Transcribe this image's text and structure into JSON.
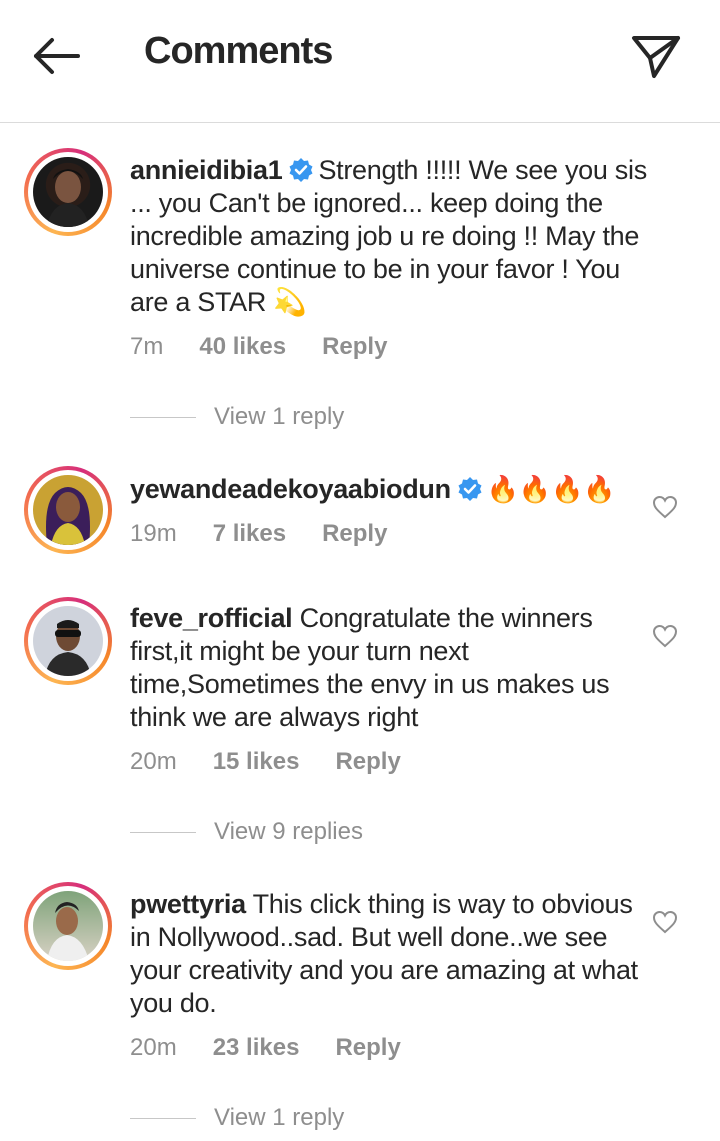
{
  "header": {
    "title": "Comments"
  },
  "comments": [
    {
      "username": "annieidibia1",
      "text": "Strength !!!!! We see you sis ... you Can't be ignored... keep doing the incredible amazing job u re  doing !! May the universe continue to be in your favor ! You are a STAR 💫",
      "time": "7m",
      "likes": "40 likes",
      "reply": "Reply",
      "view_replies": "View 1 reply"
    },
    {
      "username": "yewandeadekoyaabiodun",
      "text": "🔥🔥🔥🔥",
      "time": "19m",
      "likes": "7 likes",
      "reply": "Reply"
    },
    {
      "username": "feve_rofficial",
      "text": "Congratulate the winners first,it might be your turn next time,Sometimes the envy in us makes us think we are always right",
      "time": "20m",
      "likes": "15 likes",
      "reply": "Reply",
      "view_replies": "View 9 replies"
    },
    {
      "username": "pwettyria",
      "text": "This click thing is way to obvious in Nollywood..sad. But well done..we see your creativity and you are amazing at what you do.",
      "time": "20m",
      "likes": "23 likes",
      "reply": "Reply",
      "view_replies": "View 1 reply"
    }
  ],
  "colors": {
    "verified": "#3897f0",
    "muted": "#8e8e8e",
    "text": "#262626"
  }
}
